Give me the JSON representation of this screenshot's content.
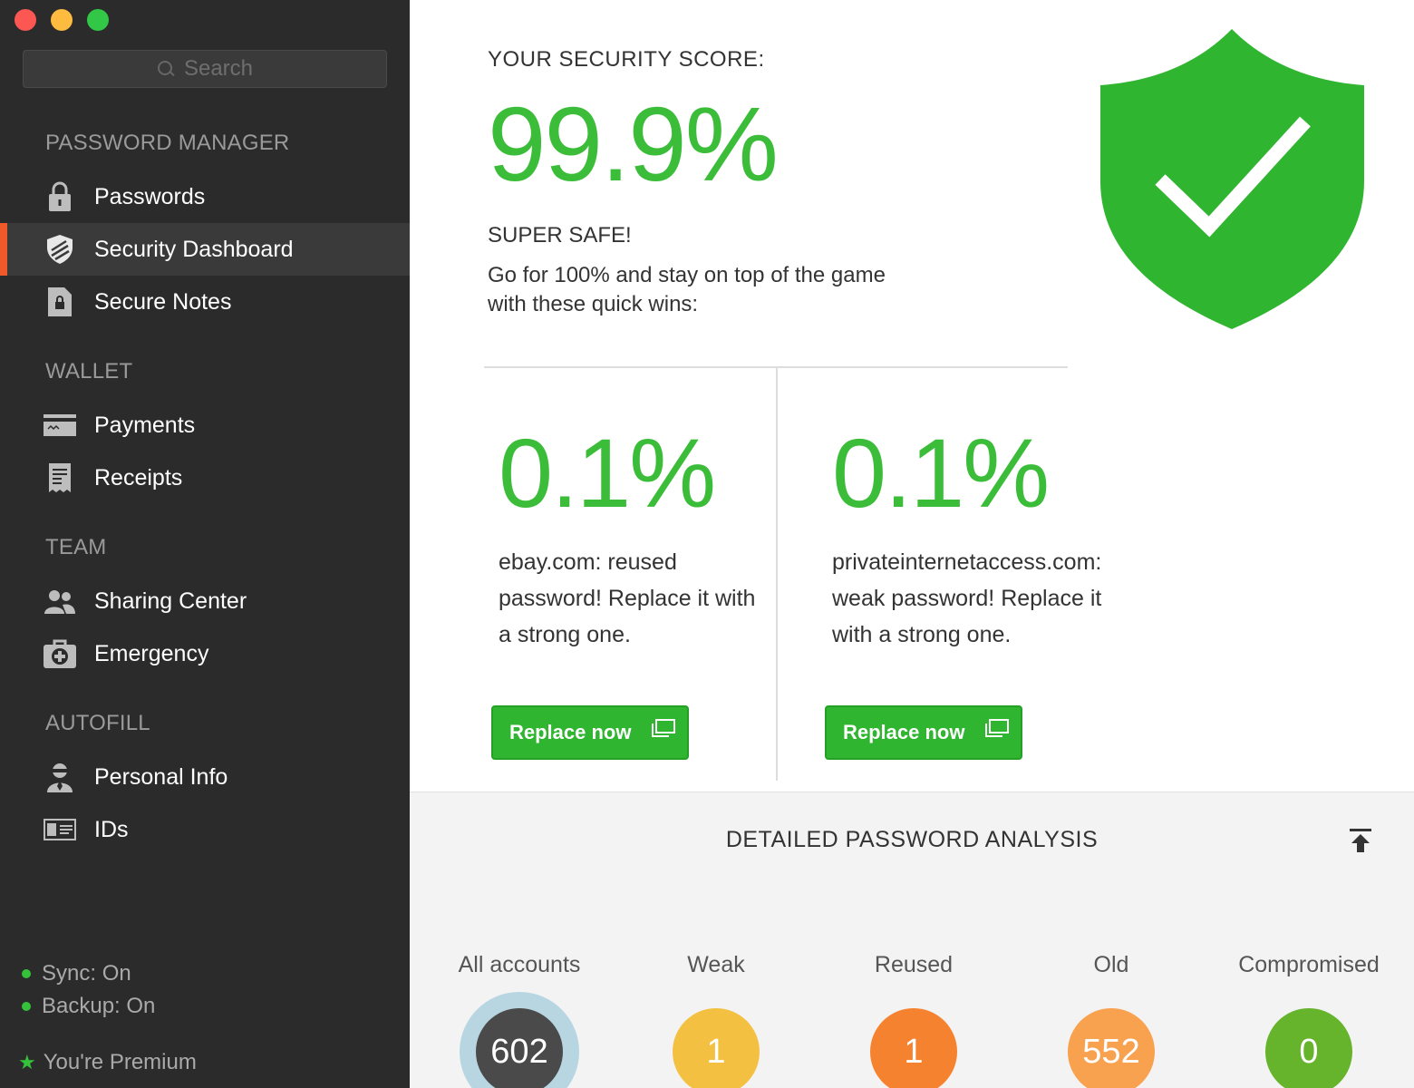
{
  "sidebar": {
    "search": {
      "placeholder": "Search"
    },
    "sections": {
      "password_manager": "PASSWORD MANAGER",
      "wallet": "WALLET",
      "team": "TEAM",
      "autofill": "AUTOFILL"
    },
    "items": {
      "passwords": "Passwords",
      "security_dashboard": "Security Dashboard",
      "secure_notes": "Secure Notes",
      "payments": "Payments",
      "receipts": "Receipts",
      "sharing_center": "Sharing Center",
      "emergency": "Emergency",
      "personal_info": "Personal Info",
      "ids": "IDs"
    },
    "status": {
      "sync": "Sync: On",
      "backup": "Backup: On",
      "premium": "You're Premium"
    }
  },
  "main": {
    "score_label": "YOUR SECURITY SCORE:",
    "score_value": "99.9%",
    "safe_label": "SUPER SAFE!",
    "safe_desc": "Go for 100% and stay on top of the game with these quick wins:",
    "cards": [
      {
        "percent": "0.1%",
        "text": "ebay.com: reused password! Replace it with a strong one.",
        "button": "Replace now"
      },
      {
        "percent": "0.1%",
        "text": "privateinternetaccess.com: weak password! Replace it with a strong one.",
        "button": "Replace now"
      }
    ],
    "analysis": {
      "title": "DETAILED PASSWORD ANALYSIS",
      "stats": [
        {
          "label": "All accounts",
          "value": "602",
          "color": "#4a4a4a"
        },
        {
          "label": "Weak",
          "value": "1",
          "color": "#f3c041"
        },
        {
          "label": "Reused",
          "value": "1",
          "color": "#f5822e"
        },
        {
          "label": "Old",
          "value": "552",
          "color": "#f8a14e"
        },
        {
          "label": "Compromised",
          "value": "0",
          "color": "#66b32c"
        }
      ]
    }
  },
  "colors": {
    "accent_green": "#3cbd3a",
    "active_indicator": "#f05a28",
    "sidebar_bg": "#2b2b2b"
  }
}
